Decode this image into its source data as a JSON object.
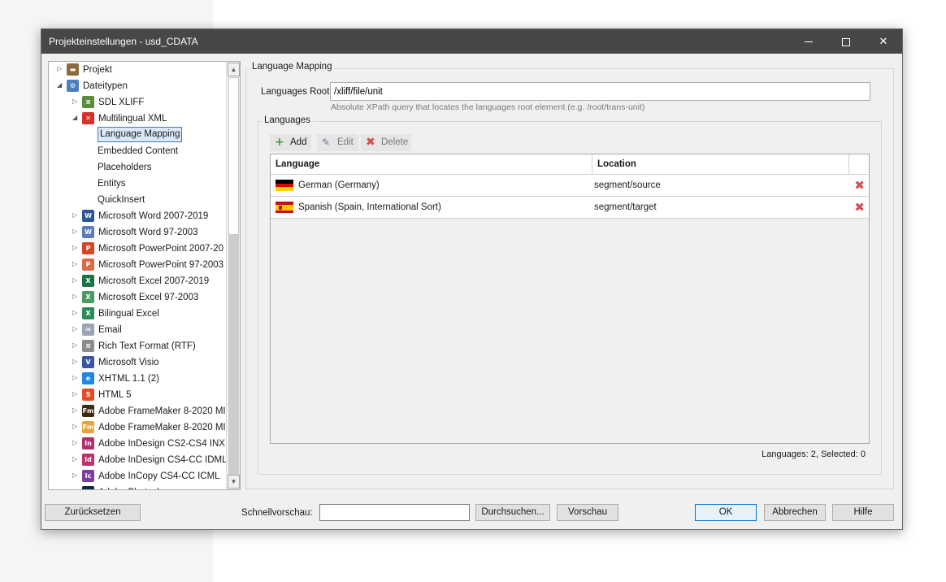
{
  "window": {
    "title": "Projekteinstellungen - usd_CDATA"
  },
  "tree": {
    "items": [
      {
        "label": "Projekt",
        "icon": "project-icon",
        "level": 0,
        "expander": "collapsed",
        "color": "#8a6b3d",
        "glyph": "▬"
      },
      {
        "label": "Dateitypen",
        "icon": "filetypes-icon",
        "level": 0,
        "expander": "expanded",
        "color": "#4a7fc0",
        "glyph": "⚙"
      },
      {
        "label": "SDL XLIFF",
        "icon": "sdl-xliff-icon",
        "level": 1,
        "expander": "collapsed",
        "color": "#5a8a3a",
        "glyph": "≡"
      },
      {
        "label": "Multilingual XML",
        "icon": "multilingual-xml-icon",
        "level": 1,
        "expander": "expanded",
        "color": "#d4322a",
        "glyph": "✕"
      },
      {
        "label": "Language Mapping",
        "icon": "",
        "level": 2,
        "expander": "none",
        "selected": true
      },
      {
        "label": "Embedded Content",
        "icon": "",
        "level": 2,
        "expander": "none"
      },
      {
        "label": "Placeholders",
        "icon": "",
        "level": 2,
        "expander": "none"
      },
      {
        "label": "Entitys",
        "icon": "",
        "level": 2,
        "expander": "none"
      },
      {
        "label": "QuickInsert",
        "icon": "",
        "level": 2,
        "expander": "none"
      },
      {
        "label": "Microsoft Word 2007-2019",
        "icon": "word-icon",
        "level": 1,
        "expander": "collapsed",
        "color": "#2b5797",
        "glyph": "W"
      },
      {
        "label": "Microsoft Word 97-2003",
        "icon": "word-legacy-icon",
        "level": 1,
        "expander": "collapsed",
        "color": "#5b7db8",
        "glyph": "W"
      },
      {
        "label": "Microsoft PowerPoint 2007-20",
        "icon": "powerpoint-icon",
        "level": 1,
        "expander": "collapsed",
        "color": "#d24726",
        "glyph": "P"
      },
      {
        "label": "Microsoft PowerPoint 97-2003",
        "icon": "powerpoint-legacy-icon",
        "level": 1,
        "expander": "collapsed",
        "color": "#d86b4a",
        "glyph": "P"
      },
      {
        "label": "Microsoft Excel 2007-2019",
        "icon": "excel-icon",
        "level": 1,
        "expander": "collapsed",
        "color": "#1e7145",
        "glyph": "X"
      },
      {
        "label": "Microsoft Excel 97-2003",
        "icon": "excel-legacy-icon",
        "level": 1,
        "expander": "collapsed",
        "color": "#4a9a62",
        "glyph": "X"
      },
      {
        "label": "Bilingual Excel",
        "icon": "bilingual-excel-icon",
        "level": 1,
        "expander": "collapsed",
        "color": "#2e8b57",
        "glyph": "X"
      },
      {
        "label": "Email",
        "icon": "email-icon",
        "level": 1,
        "expander": "collapsed",
        "color": "#9aa6b2",
        "glyph": "✉"
      },
      {
        "label": "Rich Text Format (RTF)",
        "icon": "rtf-icon",
        "level": 1,
        "expander": "collapsed",
        "color": "#8c8c8c",
        "glyph": "≡"
      },
      {
        "label": "Microsoft Visio",
        "icon": "visio-icon",
        "level": 1,
        "expander": "collapsed",
        "color": "#3955a3",
        "glyph": "V"
      },
      {
        "label": "XHTML 1.1 (2)",
        "icon": "xhtml-icon",
        "level": 1,
        "expander": "collapsed",
        "color": "#1e88e5",
        "glyph": "e"
      },
      {
        "label": "HTML 5",
        "icon": "html5-icon",
        "level": 1,
        "expander": "collapsed",
        "color": "#e44d26",
        "glyph": "5"
      },
      {
        "label": "Adobe FrameMaker 8-2020 MI",
        "icon": "framemaker-icon",
        "level": 1,
        "expander": "collapsed",
        "color": "#3d2a14",
        "glyph": "Fm"
      },
      {
        "label": "Adobe FrameMaker 8-2020 MI",
        "icon": "framemaker-alt-icon",
        "level": 1,
        "expander": "collapsed",
        "color": "#e8a33a",
        "glyph": "Fm"
      },
      {
        "label": "Adobe InDesign CS2-CS4 INX",
        "icon": "indesign-inx-icon",
        "level": 1,
        "expander": "collapsed",
        "color": "#b03070",
        "glyph": "In"
      },
      {
        "label": "Adobe InDesign CS4-CC IDML",
        "icon": "indesign-idml-icon",
        "level": 1,
        "expander": "collapsed",
        "color": "#c0306e",
        "glyph": "Id"
      },
      {
        "label": "Adobe InCopy CS4-CC ICML",
        "icon": "incopy-icon",
        "level": 1,
        "expander": "collapsed",
        "color": "#7b3fa0",
        "glyph": "Ic"
      },
      {
        "label": "Adobe Photoshop",
        "icon": "photoshop-icon",
        "level": 1,
        "expander": "collapsed",
        "color": "#0b2a4a",
        "glyph": "Ps"
      }
    ]
  },
  "mapping": {
    "group_title": "Language Mapping",
    "root_label": "Languages Root:",
    "root_value": "/xliff/file/unit",
    "root_hint": "Absolute XPath query that locates the languages root element (e.g. /root/trans-unit)",
    "languages_title": "Languages",
    "toolbar": {
      "add": "Add",
      "edit": "Edit",
      "delete": "Delete"
    },
    "columns": {
      "language": "Language",
      "location": "Location"
    },
    "rows": [
      {
        "language": "German (Germany)",
        "location": "segment/source"
      },
      {
        "language": "Spanish (Spain, International Sort)",
        "location": "segment/target"
      }
    ],
    "status": "Languages: 2, Selected: 0"
  },
  "footer": {
    "reset": "Zurücksetzen",
    "quick_preview_label": "Schnellvorschau:",
    "quick_preview_value": "",
    "browse": "Durchsuchen...",
    "preview": "Vorschau",
    "ok": "OK",
    "cancel": "Abbrechen",
    "help": "Hilfe"
  },
  "colors": {
    "titlebar": "#474747",
    "selection_border": "#3c78c8",
    "add_icon": "#3ca03c",
    "delete_icon": "#d44f4f"
  }
}
